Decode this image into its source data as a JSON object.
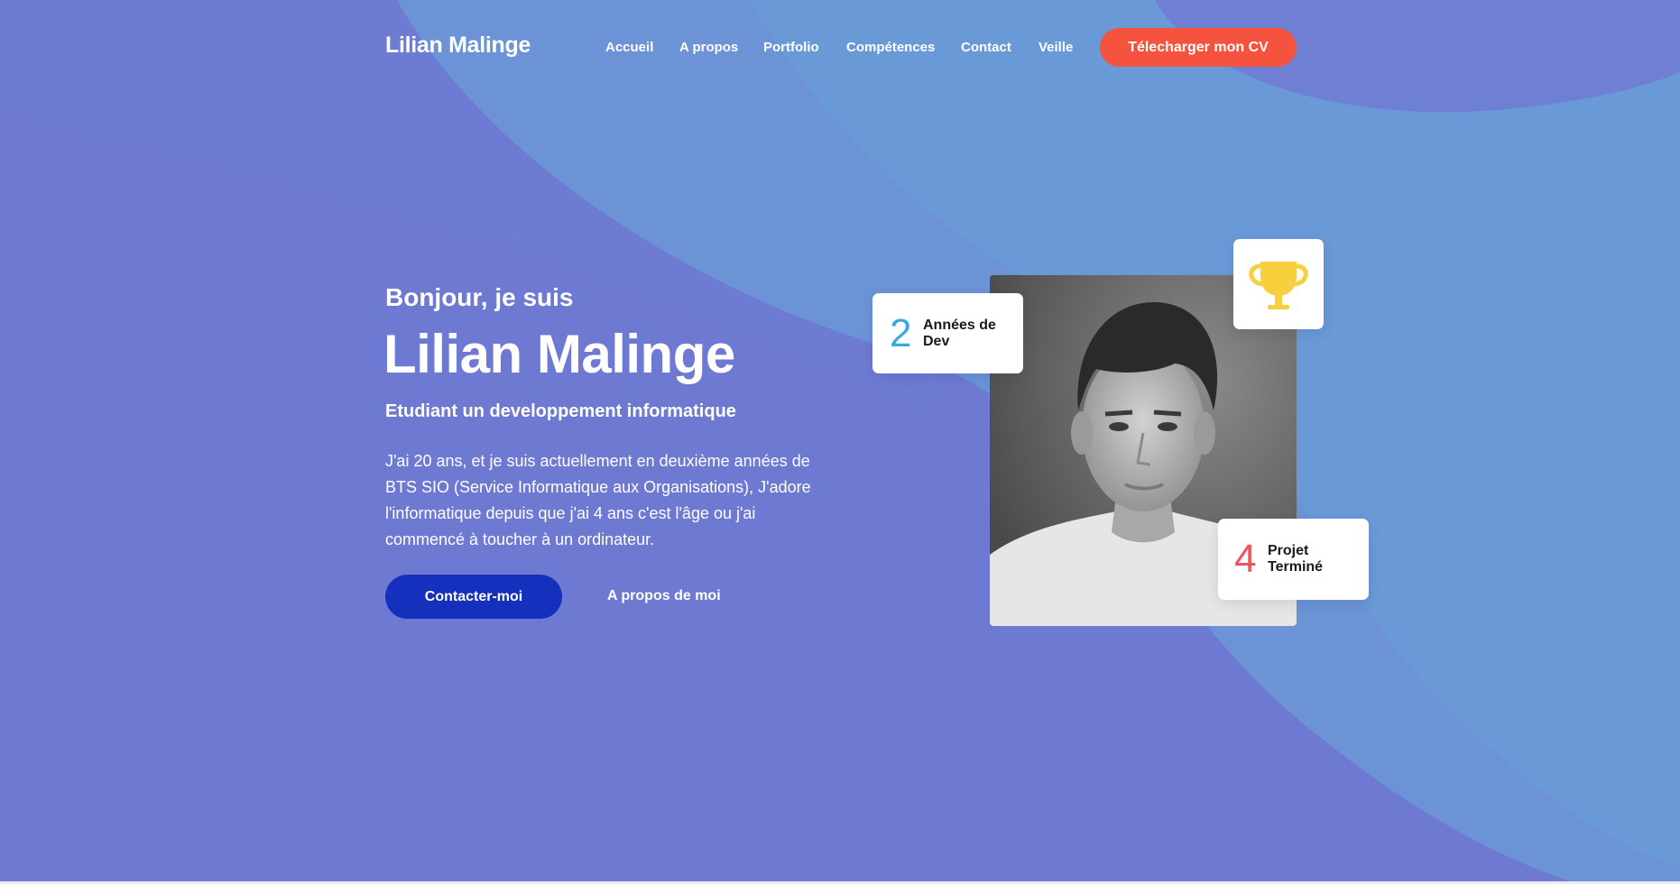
{
  "header": {
    "logo": "Lilian Malinge",
    "nav": [
      "Accueil",
      "A propos",
      "Portfolio",
      "Compétences",
      "Contact",
      "Veille"
    ],
    "cv_button": "Télecharger mon CV"
  },
  "hero": {
    "greeting": "Bonjour, je suis",
    "name": "Lilian Malinge",
    "subtitle": "Etudiant un developpement informatique",
    "description_lines": [
      "J'ai 20 ans, et je suis actuellement en deuxième années de",
      "BTS SIO (Service Informatique aux Organisations), J'adore",
      "l'informatique depuis que j'ai 4 ans c'est l'âge ou j'ai",
      "commencé à toucher à un ordinateur."
    ],
    "contact_button": "Contacter-moi",
    "about_button": "A propos de moi"
  },
  "stats": {
    "years": {
      "value": "2",
      "label_line1": "Années de",
      "label_line2": "Dev"
    },
    "projects": {
      "value": "4",
      "label_line1": "Projet",
      "label_line2": "Terminé"
    }
  },
  "icons": {
    "trophy": "trophy-icon",
    "profile_photo": "portrait"
  },
  "colors": {
    "background": "#6e79d1",
    "cv_button": "#f5533d",
    "contact_button": "#1530bd",
    "years_number": "#3aa8e0",
    "projects_number": "#f0535e",
    "trophy": "#f8cf3c"
  }
}
